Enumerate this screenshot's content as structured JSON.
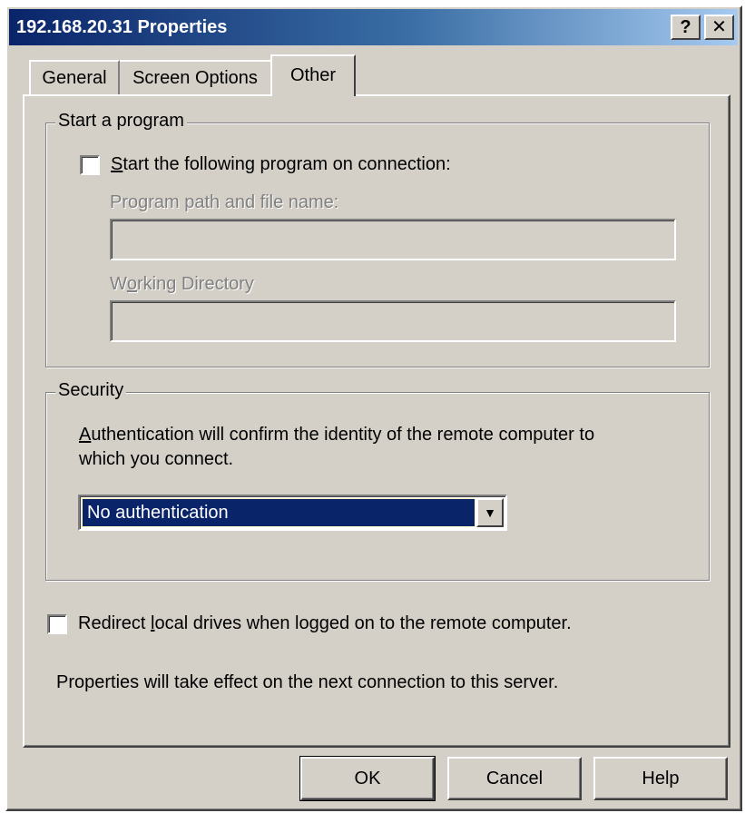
{
  "window": {
    "title": "192.168.20.31 Properties",
    "help_button": "?",
    "close_button": "✕"
  },
  "tabs": [
    {
      "label": "General",
      "active": false
    },
    {
      "label": "Screen Options",
      "active": false
    },
    {
      "label": "Other",
      "active": true
    }
  ],
  "start_program": {
    "legend": "Start a program",
    "checkbox": {
      "label_mnemonic": "S",
      "label_rest": "tart the following program on connection:",
      "checked": false
    },
    "program_path": {
      "label": "Program path and file name:",
      "value": ""
    },
    "working_directory": {
      "label_before": "W",
      "label_mnemonic": "o",
      "label_after": "rking Directory",
      "value": ""
    }
  },
  "security": {
    "legend": "Security",
    "description_mnemonic": "A",
    "description_line1_rest": "uthentication will confirm the identity of the remote computer to",
    "description_line2": "which you connect.",
    "authentication": {
      "selected": "No authentication"
    }
  },
  "redirect": {
    "label_before": "Redirect ",
    "label_mnemonic": "l",
    "label_after": "ocal drives when logged on to the remote computer.",
    "checked": false
  },
  "note": "Properties will take effect on the next connection to this server.",
  "buttons": {
    "ok": "OK",
    "cancel": "Cancel",
    "help": "Help"
  }
}
